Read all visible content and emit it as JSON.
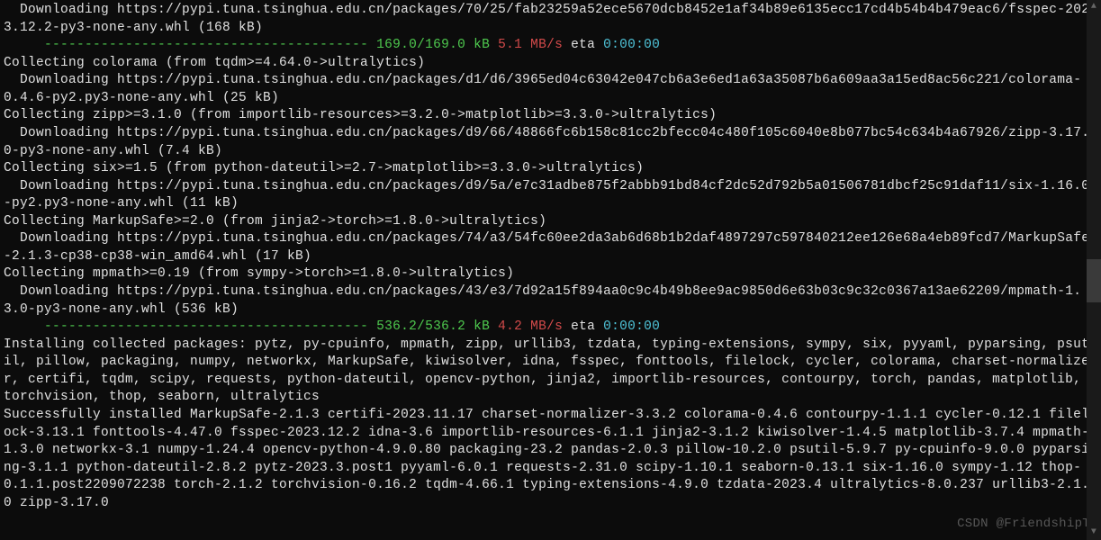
{
  "lines": [
    {
      "segments": [
        {
          "t": "  Downloading https://pypi.tuna.tsinghua.edu.cn/packages/70/25/fab23259a52ece5670dcb8452e1af34b89e6135ecc17cd4b54b4b479eac6/fsspec-2023.12.2-py3-none-any.whl (168 kB)",
          "c": "white"
        }
      ]
    },
    {
      "segments": [
        {
          "t": "     ",
          "c": "white"
        },
        {
          "t": "---------------------------------------- 169.0/169.0 kB",
          "c": "green"
        },
        {
          "t": " 5.1 MB/s",
          "c": "red"
        },
        {
          "t": " eta",
          "c": "white"
        },
        {
          "t": " 0:00:00",
          "c": "cyan"
        }
      ]
    },
    {
      "segments": [
        {
          "t": "Collecting colorama (from tqdm>=4.64.0->ultralytics)",
          "c": "white"
        }
      ]
    },
    {
      "segments": [
        {
          "t": "  Downloading https://pypi.tuna.tsinghua.edu.cn/packages/d1/d6/3965ed04c63042e047cb6a3e6ed1a63a35087b6a609aa3a15ed8ac56c221/colorama-0.4.6-py2.py3-none-any.whl (25 kB)",
          "c": "white"
        }
      ]
    },
    {
      "segments": [
        {
          "t": "Collecting zipp>=3.1.0 (from importlib-resources>=3.2.0->matplotlib>=3.3.0->ultralytics)",
          "c": "white"
        }
      ]
    },
    {
      "segments": [
        {
          "t": "  Downloading https://pypi.tuna.tsinghua.edu.cn/packages/d9/66/48866fc6b158c81cc2bfecc04c480f105c6040e8b077bc54c634b4a67926/zipp-3.17.0-py3-none-any.whl (7.4 kB)",
          "c": "white"
        }
      ]
    },
    {
      "segments": [
        {
          "t": "Collecting six>=1.5 (from python-dateutil>=2.7->matplotlib>=3.3.0->ultralytics)",
          "c": "white"
        }
      ]
    },
    {
      "segments": [
        {
          "t": "  Downloading https://pypi.tuna.tsinghua.edu.cn/packages/d9/5a/e7c31adbe875f2abbb91bd84cf2dc52d792b5a01506781dbcf25c91daf11/six-1.16.0-py2.py3-none-any.whl (11 kB)",
          "c": "white"
        }
      ]
    },
    {
      "segments": [
        {
          "t": "Collecting MarkupSafe>=2.0 (from jinja2->torch>=1.8.0->ultralytics)",
          "c": "white"
        }
      ]
    },
    {
      "segments": [
        {
          "t": "  Downloading https://pypi.tuna.tsinghua.edu.cn/packages/74/a3/54fc60ee2da3ab6d68b1b2daf4897297c597840212ee126e68a4eb89fcd7/MarkupSafe-2.1.3-cp38-cp38-win_amd64.whl (17 kB)",
          "c": "white"
        }
      ]
    },
    {
      "segments": [
        {
          "t": "Collecting mpmath>=0.19 (from sympy->torch>=1.8.0->ultralytics)",
          "c": "white"
        }
      ]
    },
    {
      "segments": [
        {
          "t": "  Downloading https://pypi.tuna.tsinghua.edu.cn/packages/43/e3/7d92a15f894aa0c9c4b49b8ee9ac9850d6e63b03c9c32c0367a13ae62209/mpmath-1.3.0-py3-none-any.whl (536 kB)",
          "c": "white"
        }
      ]
    },
    {
      "segments": [
        {
          "t": "     ",
          "c": "white"
        },
        {
          "t": "---------------------------------------- 536.2/536.2 kB",
          "c": "green"
        },
        {
          "t": " 4.2 MB/s",
          "c": "red"
        },
        {
          "t": " eta",
          "c": "white"
        },
        {
          "t": " 0:00:00",
          "c": "cyan"
        }
      ]
    },
    {
      "segments": [
        {
          "t": "Installing collected packages: pytz, py-cpuinfo, mpmath, zipp, urllib3, tzdata, typing-extensions, sympy, six, pyyaml, pyparsing, psutil, pillow, packaging, numpy, networkx, MarkupSafe, kiwisolver, idna, fsspec, fonttools, filelock, cycler, colorama, charset-normalizer, certifi, tqdm, scipy, requests, python-dateutil, opencv-python, jinja2, importlib-resources, contourpy, torch, pandas, matplotlib, torchvision, thop, seaborn, ultralytics",
          "c": "white"
        }
      ]
    },
    {
      "segments": [
        {
          "t": "Successfully installed MarkupSafe-2.1.3 certifi-2023.11.17 charset-normalizer-3.3.2 colorama-0.4.6 contourpy-1.1.1 cycler-0.12.1 filelock-3.13.1 fonttools-4.47.0 fsspec-2023.12.2 idna-3.6 importlib-resources-6.1.1 jinja2-3.1.2 kiwisolver-1.4.5 matplotlib-3.7.4 mpmath-1.3.0 networkx-3.1 numpy-1.24.4 opencv-python-4.9.0.80 packaging-23.2 pandas-2.0.3 pillow-10.2.0 psutil-5.9.7 py-cpuinfo-9.0.0 pyparsing-3.1.1 python-dateutil-2.8.2 pytz-2023.3.post1 pyyaml-6.0.1 requests-2.31.0 scipy-1.10.1 seaborn-0.13.1 six-1.16.0 sympy-1.12 thop-0.1.1.post2209072238 torch-2.1.2 torchvision-0.16.2 tqdm-4.66.1 typing-extensions-4.9.0 tzdata-2023.4 ultralytics-8.0.237 urllib3-2.1.0 zipp-3.17.0",
          "c": "white"
        }
      ]
    }
  ],
  "watermark": "CSDN @FriendshipT",
  "scrollbar": {
    "arrow_up": "▲",
    "arrow_down": "▼"
  }
}
